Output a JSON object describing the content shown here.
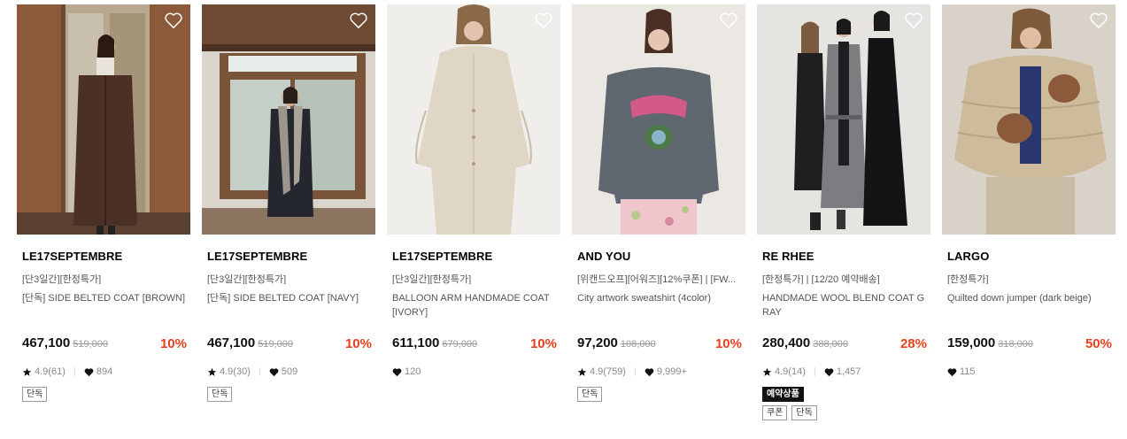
{
  "products": [
    {
      "brand": "LE17SEPTEMBRE",
      "tagline": "[단3일간][한정특가]",
      "name": "[단독] SIDE BELTED COAT [BROWN]",
      "price": "467,100",
      "original_price": "519,000",
      "discount": "10%",
      "rating": "4.9(61)",
      "likes": "894",
      "badges_dark": [],
      "badges": [
        "단독"
      ]
    },
    {
      "brand": "LE17SEPTEMBRE",
      "tagline": "[단3일간][한정특가]",
      "name": "[단독] SIDE BELTED COAT [NAVY]",
      "price": "467,100",
      "original_price": "519,000",
      "discount": "10%",
      "rating": "4.9(30)",
      "likes": "509",
      "badges_dark": [],
      "badges": [
        "단독"
      ]
    },
    {
      "brand": "LE17SEPTEMBRE",
      "tagline": "[단3일간][한정특가]",
      "name": "BALLOON ARM HANDMADE COAT [IVORY]",
      "price": "611,100",
      "original_price": "679,000",
      "discount": "10%",
      "rating": "",
      "likes": "120",
      "badges_dark": [],
      "badges": []
    },
    {
      "brand": "AND YOU",
      "tagline": "[위캔드오프][어워즈][12%쿠폰] | [FW...",
      "name": "City artwork sweatshirt (4color)",
      "price": "97,200",
      "original_price": "108,000",
      "discount": "10%",
      "rating": "4.9(759)",
      "likes": "9,999+",
      "badges_dark": [],
      "badges": [
        "단독"
      ]
    },
    {
      "brand": "RE RHEE",
      "tagline": "[한정특가] | [12/20 예약배송]",
      "name": "HANDMADE WOOL BLEND COAT GRAY",
      "price": "280,400",
      "original_price": "388,000",
      "discount": "28%",
      "rating": "4.9(14)",
      "likes": "1,457",
      "badges_dark": [
        "예약상품"
      ],
      "badges": [
        "쿠폰",
        "단독"
      ]
    },
    {
      "brand": "LARGO",
      "tagline": "[한정특가]",
      "name": "Quilted down jumper (dark beige)",
      "price": "159,000",
      "original_price": "318,000",
      "discount": "50%",
      "rating": "",
      "likes": "115",
      "badges_dark": [],
      "badges": []
    }
  ],
  "colors": {
    "discount": "#e8401c",
    "price": "#111111",
    "muted": "#888888"
  },
  "icons": {
    "wishlist": "heart-outline-icon",
    "rating": "star-icon",
    "likes": "heart-filled-icon"
  }
}
